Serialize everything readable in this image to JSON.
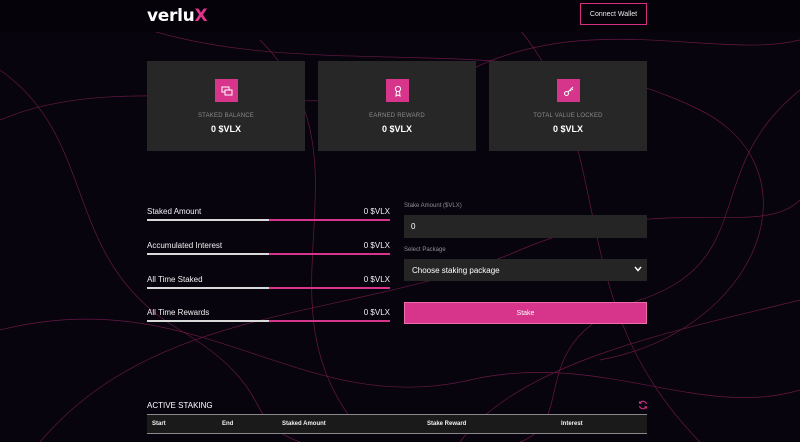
{
  "header": {
    "logo_main": "verlu",
    "logo_accent": "X",
    "connect_label": "Connect Wallet"
  },
  "cards": [
    {
      "label": "STAKED BALANCE",
      "value": "0 $VLX",
      "icon": "coins-icon"
    },
    {
      "label": "EARNED REWARD",
      "value": "0 $VLX",
      "icon": "award-icon"
    },
    {
      "label": "TOTAL VALUE LOCKED",
      "value": "0 $VLX",
      "icon": "key-icon"
    }
  ],
  "stats": [
    {
      "name": "Staked Amount",
      "value": "0 $VLX",
      "progress": 0.5
    },
    {
      "name": "Accumulated Interest",
      "value": "0 $VLX",
      "progress": 0.5
    },
    {
      "name": "All Time Staked",
      "value": "0 $VLX",
      "progress": 0.5
    },
    {
      "name": "All Time Rewards",
      "value": "0 $VLX",
      "progress": 0.5
    }
  ],
  "form": {
    "amount_label": "Stake Amount ($VLX)",
    "amount_value": "0",
    "package_label": "Select Package",
    "package_selected": "Choose staking package",
    "stake_label": "Stake"
  },
  "active": {
    "title": "ACTIVE STAKING",
    "columns": [
      "Start",
      "End",
      "Staked Amount",
      "Stake Reward",
      "Interest"
    ]
  },
  "colors": {
    "accent": "#d6358b",
    "background": "#07040e",
    "card": "#272727"
  }
}
